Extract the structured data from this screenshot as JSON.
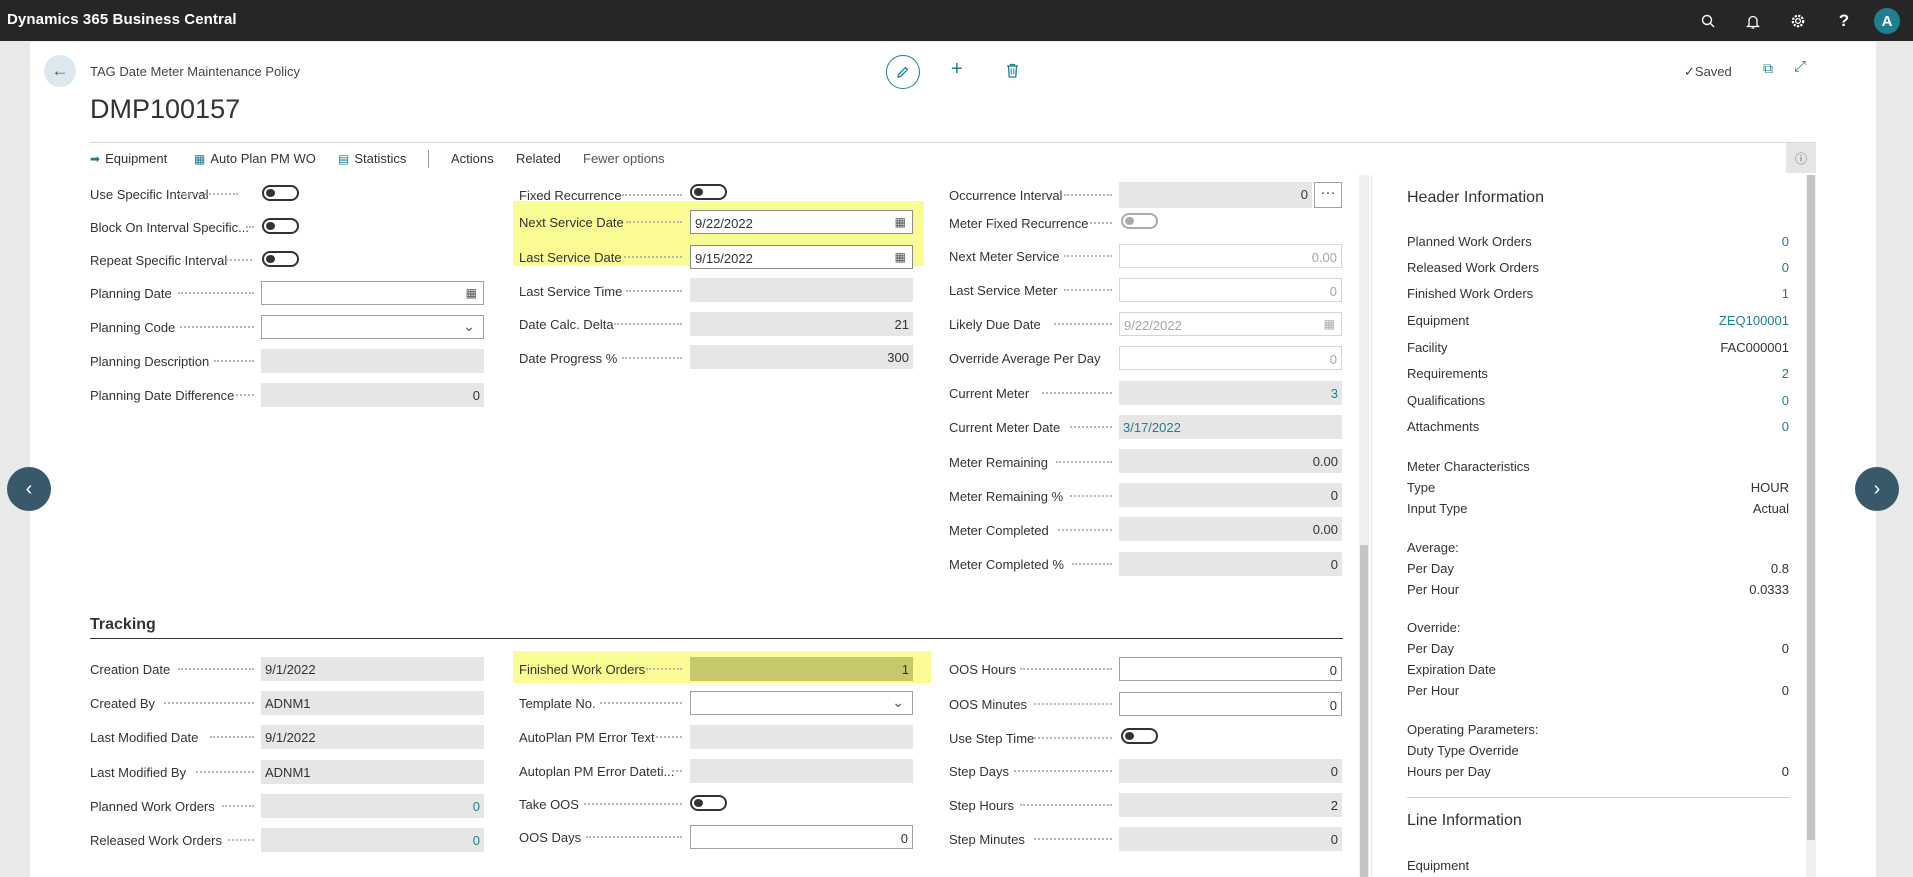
{
  "app": {
    "title": "Dynamics 365 Business Central",
    "avatar": "A"
  },
  "topbar_icons": [
    "search-icon",
    "bell-icon",
    "gear-icon",
    "help-icon"
  ],
  "page": {
    "caption": "TAG Date Meter Maintenance Policy",
    "title": "DMP100157",
    "status": "Saved"
  },
  "actions": {
    "equipment": "Equipment",
    "auto_plan": "Auto Plan PM WO",
    "statistics": "Statistics",
    "actions": "Actions",
    "related": "Related",
    "fewer": "Fewer options"
  },
  "col1": {
    "use_specific_interval": "Use Specific Interval",
    "block_on_interval": "Block On Interval Specific...",
    "repeat_specific_interval": "Repeat Specific Interval",
    "planning_date": "Planning Date",
    "planning_code": "Planning Code",
    "planning_description": "Planning Description",
    "planning_date_difference": "Planning Date Difference",
    "planning_date_difference_value": "0"
  },
  "col2": {
    "fixed_recurrence": "Fixed Recurrence",
    "next_service_date": "Next Service Date",
    "next_service_date_value": "9/22/2022",
    "last_service_date": "Last Service Date",
    "last_service_date_value": "9/15/2022",
    "last_service_time": "Last Service Time",
    "date_calc_delta": "Date Calc. Delta",
    "date_calc_delta_value": "21",
    "date_progress": "Date Progress %",
    "date_progress_value": "300"
  },
  "col3": {
    "occurrence_interval": "Occurrence Interval",
    "occurrence_interval_value": "0",
    "meter_fixed_recurrence": "Meter Fixed Recurrence",
    "next_meter_service": "Next Meter Service",
    "next_meter_service_value": "0.00",
    "last_service_meter": "Last Service Meter",
    "last_service_meter_value": "0",
    "likely_due_date": "Likely Due Date",
    "likely_due_date_value": "9/22/2022",
    "override_average": "Override Average Per Day",
    "override_average_value": "0",
    "current_meter": "Current Meter",
    "current_meter_value": "3",
    "current_meter_date": "Current Meter Date",
    "current_meter_date_value": "3/17/2022",
    "meter_remaining": "Meter Remaining",
    "meter_remaining_value": "0.00",
    "meter_remaining_pct": "Meter Remaining %",
    "meter_remaining_pct_value": "0",
    "meter_completed": "Meter Completed",
    "meter_completed_value": "0.00",
    "meter_completed_pct": "Meter Completed %",
    "meter_completed_pct_value": "0"
  },
  "tracking": {
    "title": "Tracking",
    "creation_date": "Creation Date",
    "creation_date_value": "9/1/2022",
    "created_by": "Created By",
    "created_by_value": "ADNM1",
    "last_modified_date": "Last Modified Date",
    "last_modified_date_value": "9/1/2022",
    "last_modified_by": "Last Modified By",
    "last_modified_by_value": "ADNM1",
    "planned_work_orders": "Planned Work Orders",
    "planned_work_orders_value": "0",
    "released_work_orders": "Released Work Orders",
    "released_work_orders_value": "0",
    "finished_work_orders": "Finished Work Orders",
    "finished_work_orders_value": "1",
    "template_no": "Template No.",
    "autoplan_error_text": "AutoPlan PM Error Text",
    "autoplan_error_datetime": "Autoplan PM Error Dateti...",
    "take_oos": "Take OOS",
    "oos_days": "OOS Days",
    "oos_days_value": "0",
    "oos_hours": "OOS Hours",
    "oos_hours_value": "0",
    "oos_minutes": "OOS Minutes",
    "oos_minutes_value": "0",
    "use_step_time": "Use Step Time",
    "step_days": "Step Days",
    "step_days_value": "0",
    "step_hours": "Step Hours",
    "step_hours_value": "2",
    "step_minutes": "Step Minutes",
    "step_minutes_value": "0"
  },
  "factbox": {
    "header_title": "Header Information",
    "rows": [
      {
        "label": "Planned Work Orders",
        "value": "0",
        "link": true
      },
      {
        "label": "Released Work Orders",
        "value": "0",
        "link": true
      },
      {
        "label": "Finished Work Orders",
        "value": "1",
        "link": true
      },
      {
        "label": "Equipment",
        "value": "ZEQ100001",
        "link": true
      },
      {
        "label": "Facility",
        "value": "FAC000001",
        "link": false
      },
      {
        "label": "Requirements",
        "value": "2",
        "link": true
      },
      {
        "label": "Qualifications",
        "value": "0",
        "link": true
      },
      {
        "label": "Attachments",
        "value": "0",
        "link": true
      }
    ],
    "meter_characteristics": "Meter Characteristics",
    "type_label": "Type",
    "type_value": "HOUR",
    "input_type_label": "Input Type",
    "input_type_value": "Actual",
    "average": "Average:",
    "avg_per_day_label": "Per Day",
    "avg_per_day_value": "0.8",
    "avg_per_hour_label": "Per Hour",
    "avg_per_hour_value": "0.0333",
    "override": "Override:",
    "ovr_per_day_label": "Per Day",
    "ovr_per_day_value": "0",
    "expiration_date_label": "Expiration Date",
    "ovr_per_hour_label": "Per Hour",
    "ovr_per_hour_value": "0",
    "operating_parameters": "Operating Parameters:",
    "duty_type_override_label": "Duty Type Override",
    "hours_per_day_label": "Hours per Day",
    "hours_per_day_value": "0",
    "line_title": "Line Information",
    "line_equipment_label": "Equipment"
  },
  "colors": {
    "accent": "#1e7f8e",
    "highlight": "#fbfb94",
    "topbar": "#262626"
  }
}
